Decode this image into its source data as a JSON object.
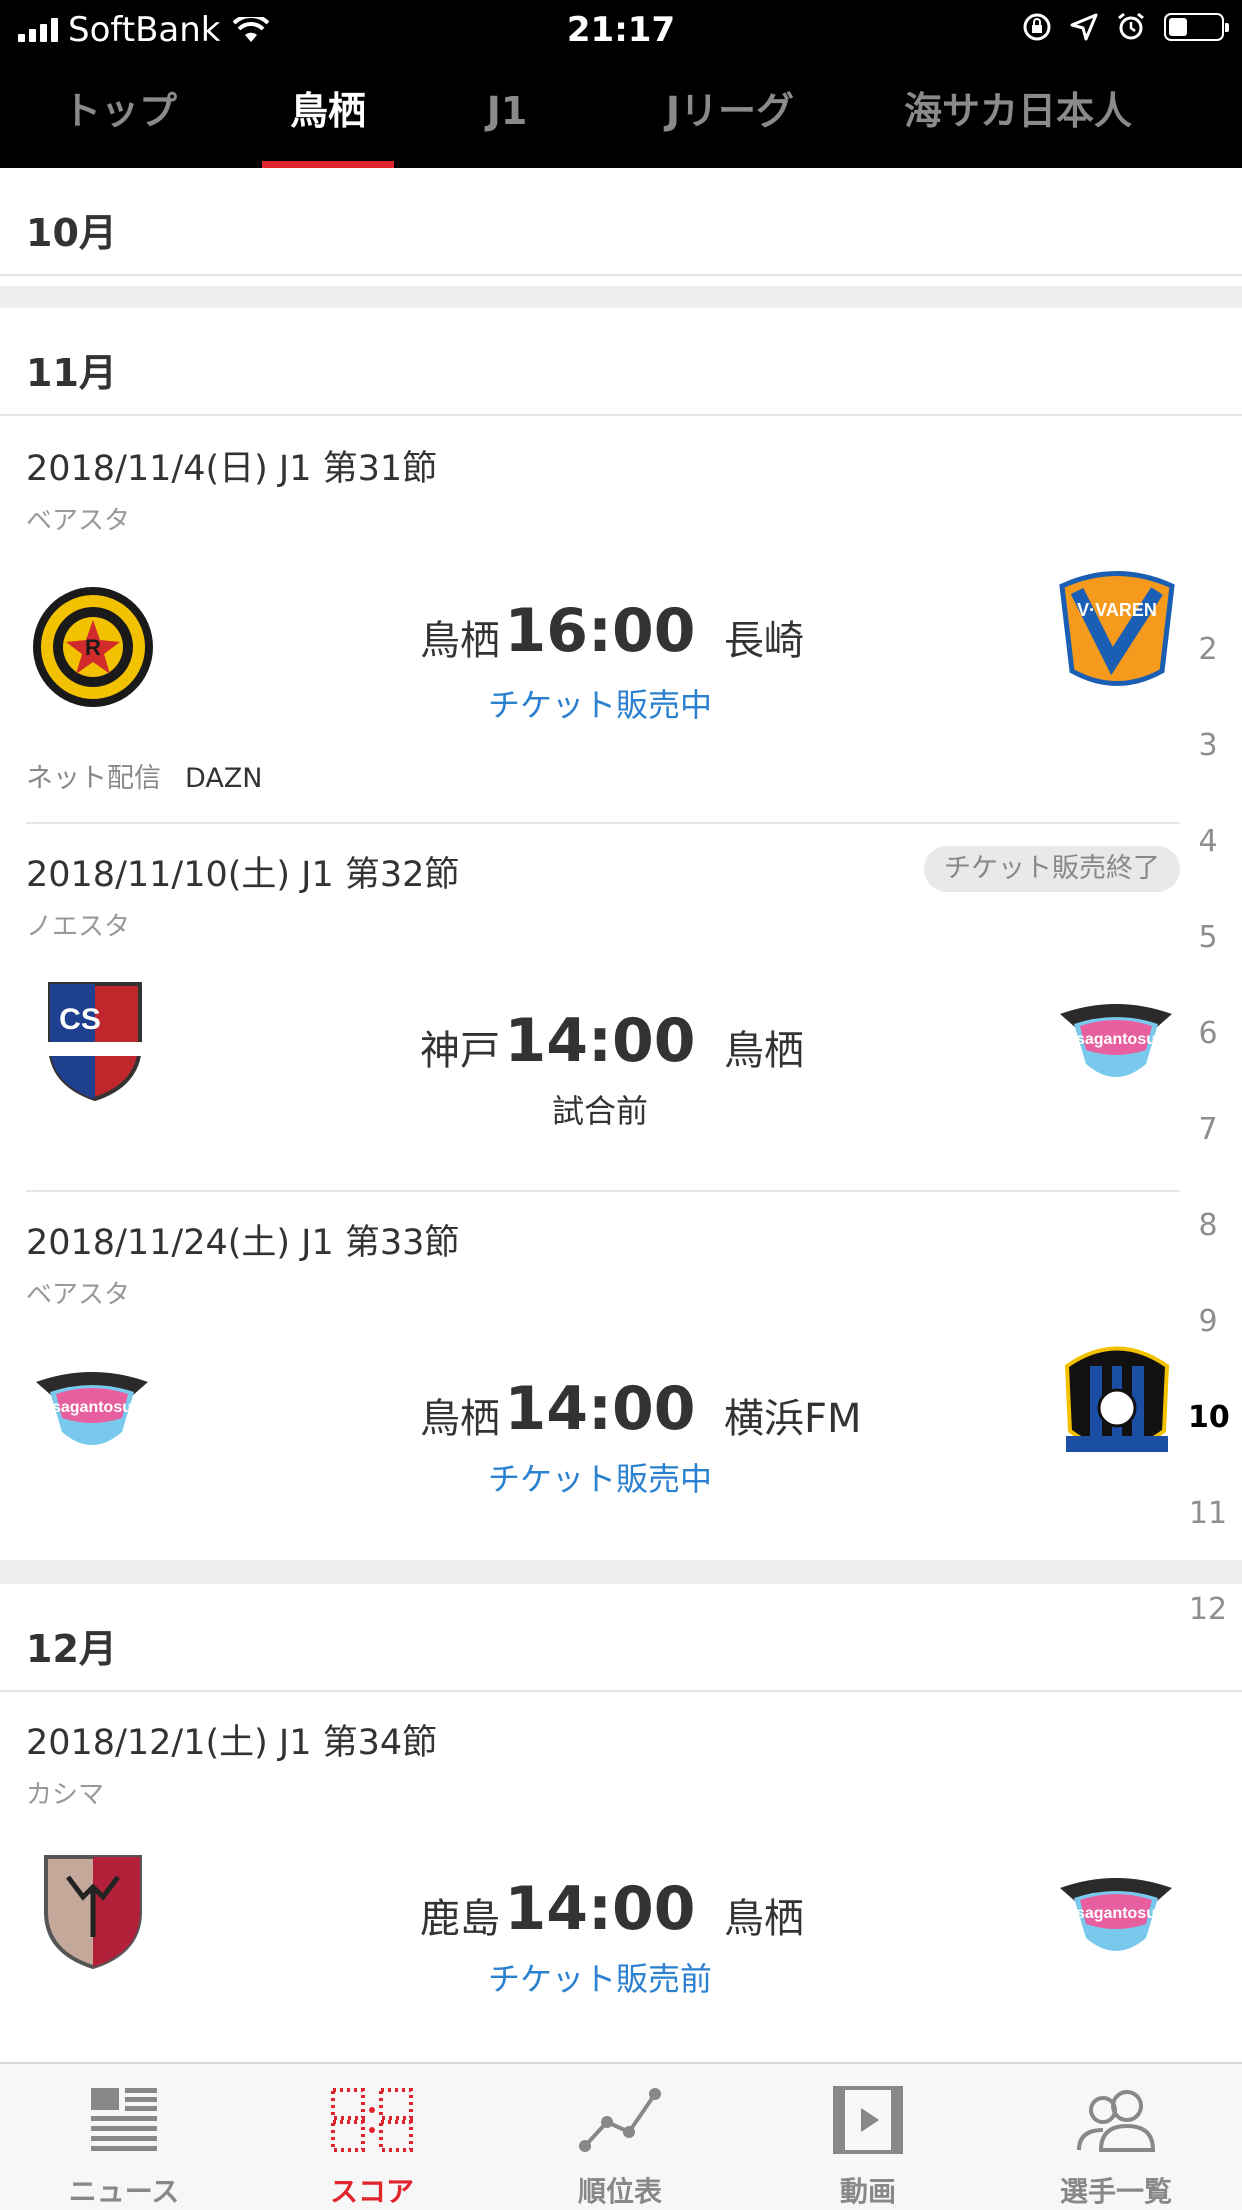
{
  "status_bar": {
    "carrier": "SoftBank",
    "time": "21:17",
    "battery_level": 0.35
  },
  "top_tabs": [
    {
      "label": "トップ",
      "active": false
    },
    {
      "label": "鳥栖",
      "active": true
    },
    {
      "label": "J1",
      "active": false
    },
    {
      "label": "Jリーグ",
      "active": false
    },
    {
      "label": "海サカ日本人",
      "active": false
    }
  ],
  "months": {
    "oct": "10月",
    "nov": "11月",
    "dec": "12月"
  },
  "matches": [
    {
      "date": "2018/11/4(日) J1 第31節",
      "venue": "ベアスタ",
      "home": "鳥栖",
      "time": "16:00",
      "away": "長崎",
      "status": "チケット販売中",
      "broadcast_label": "ネット配信",
      "broadcast_value": "DAZN",
      "left_logo": "kashiwa-reysol-logo",
      "right_logo": "v-varen-nagasaki-logo"
    },
    {
      "date": "2018/11/10(土) J1 第32節",
      "venue": "ノエスタ",
      "home": "神戸",
      "time": "14:00",
      "away": "鳥栖",
      "status": "試合前",
      "badge": "チケット販売終了",
      "left_logo": "consadole-sapporo-logo",
      "right_logo": "sagan-tosu-logo"
    },
    {
      "date": "2018/11/24(土) J1 第33節",
      "venue": "ベアスタ",
      "home": "鳥栖",
      "time": "14:00",
      "away": "横浜FM",
      "status": "チケット販売中",
      "left_logo": "sagan-tosu-logo",
      "right_logo": "gamba-osaka-logo"
    },
    {
      "date": "2018/12/1(土) J1 第34節",
      "venue": "カシマ",
      "home": "鹿島",
      "time": "14:00",
      "away": "鳥栖",
      "status": "チケット販売前",
      "left_logo": "kashima-antlers-logo",
      "right_logo": "sagan-tosu-logo"
    }
  ],
  "month_index": [
    "2",
    "3",
    "4",
    "5",
    "6",
    "7",
    "8",
    "9",
    "10",
    "11",
    "12"
  ],
  "month_index_current": "10",
  "bottom_nav": [
    {
      "label": "ニュース",
      "icon": "news-icon",
      "active": false
    },
    {
      "label": "スコア",
      "icon": "score-icon",
      "active": true
    },
    {
      "label": "順位表",
      "icon": "standings-icon",
      "active": false
    },
    {
      "label": "動画",
      "icon": "video-icon",
      "active": false
    },
    {
      "label": "選手一覧",
      "icon": "players-icon",
      "active": false
    }
  ],
  "colors": {
    "accent": "#e0242b",
    "link": "#2b80d0",
    "header_bg": "#000000"
  }
}
